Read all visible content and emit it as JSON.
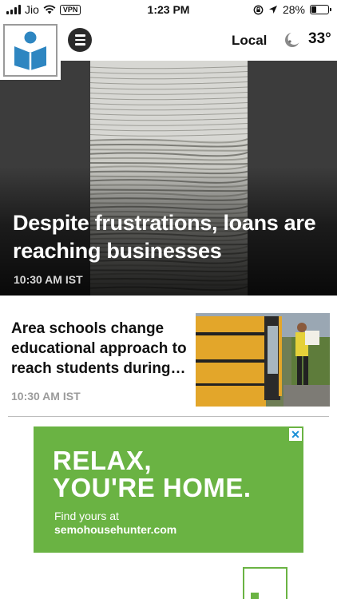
{
  "status_bar": {
    "carrier": "Jio",
    "vpn": "VPN",
    "time": "1:23 PM",
    "battery": "28%",
    "battery_level": 0.28
  },
  "header": {
    "local_label": "Local",
    "temperature": "33°",
    "weather_icon": "moon-icon",
    "menu_icon": "hamburger-menu-icon",
    "logo_icon": "reader-book-logo-icon",
    "brand_color": "#2e86c1"
  },
  "hero": {
    "title": "Despite frustrations, loans are reaching businesses",
    "time": "10:30 AM IST"
  },
  "stories": [
    {
      "title": "Area schools change educational approach to reach students during…",
      "time": "10:30 AM IST"
    }
  ],
  "ad": {
    "headline_line1": "RELAX,",
    "headline_line2": "YOU'RE HOME.",
    "sub": "Find yours at",
    "url": "semohousehunter.com",
    "close_label": "✕",
    "color": "#6ab343"
  }
}
